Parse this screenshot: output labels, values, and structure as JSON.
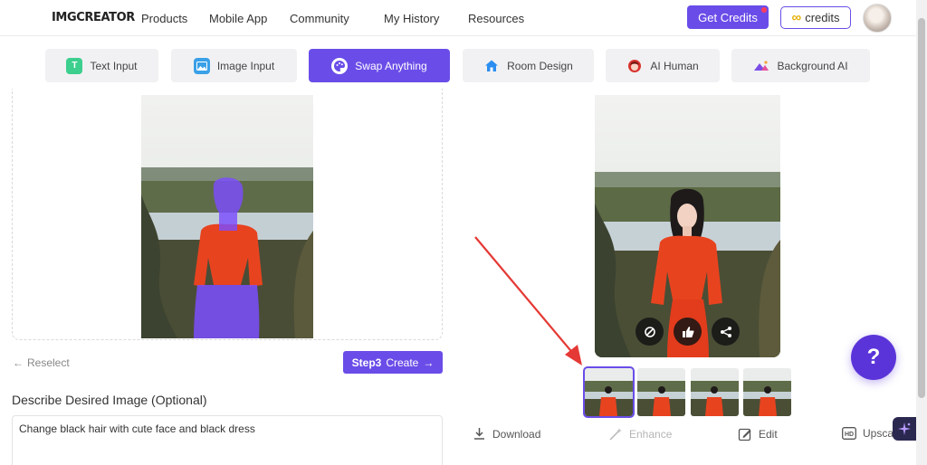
{
  "header": {
    "logo": "IMGCREATOR",
    "nav": [
      "Products",
      "Mobile App",
      "Community",
      "My History",
      "Resources"
    ],
    "get_credits": "Get Credits",
    "credits_label": "credits"
  },
  "tabs": [
    {
      "label": "Text Input",
      "icon": "text-input-icon",
      "active": false
    },
    {
      "label": "Image Input",
      "icon": "image-input-icon",
      "active": false
    },
    {
      "label": "Swap Anything",
      "icon": "palette-icon",
      "active": true
    },
    {
      "label": "Room Design",
      "icon": "house-icon",
      "active": false
    },
    {
      "label": "AI Human",
      "icon": "ai-human-icon",
      "active": false
    },
    {
      "label": "Background AI",
      "icon": "mountain-icon",
      "active": false
    }
  ],
  "left": {
    "reselect": "Reselect",
    "create_step": "Step3",
    "create_label": "Create",
    "describe_label": "Describe Desired Image (Optional)",
    "prompt_value": "Change black hair with cute face and black dress"
  },
  "right": {
    "tools": {
      "download": "Download",
      "enhance": "Enhance",
      "edit": "Edit",
      "upscale": "Upsca"
    },
    "thumbnails_count": 4,
    "selected_thumbnail": 1
  },
  "help": "?",
  "colors": {
    "accent": "#6a4de8",
    "help_button": "#5b34d9",
    "mask_overlay": "#7b4dff",
    "dress_red": "#e8431f",
    "annotation_arrow": "#e53935"
  }
}
